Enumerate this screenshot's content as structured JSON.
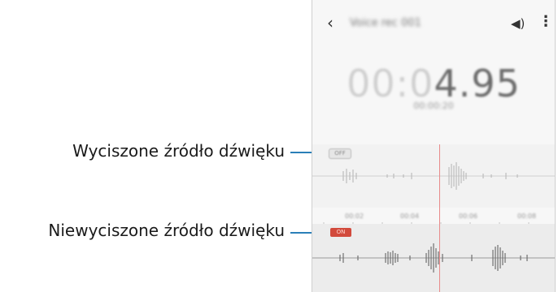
{
  "callouts": {
    "muted": "Wyciszone źródło dźwięku",
    "unmuted": "Niewyciszone źródło dźwięku"
  },
  "appbar": {
    "back_icon": "‹",
    "title": "Voice rec 001",
    "speaker_icon": "◀)",
    "more_icon": "⋮"
  },
  "timer": {
    "dim_part": "00:0",
    "bright_part": "4.95",
    "sub": "00:00:20"
  },
  "tracks": {
    "track1_button": "OFF",
    "track2_button": "ON"
  },
  "ruler": {
    "ticks": [
      "00:02",
      "00:04",
      "00:06",
      "00:08"
    ]
  },
  "colors": {
    "callout_line": "#2a7fb8",
    "active_button": "#d24a3c",
    "playhead": "#e88a8a"
  }
}
